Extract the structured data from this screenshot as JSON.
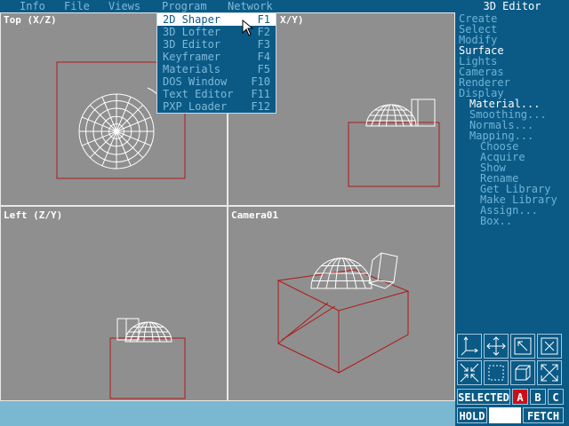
{
  "menu": {
    "items": [
      "Info",
      "File",
      "Views",
      "Program",
      "Network"
    ]
  },
  "dropdown": {
    "items": [
      {
        "label": "2D Shaper",
        "key": "F1",
        "selected": true
      },
      {
        "label": "3D Lofter",
        "key": "F2"
      },
      {
        "label": "3D Editor",
        "key": "F3"
      },
      {
        "label": "Keyframer",
        "key": "F4"
      },
      {
        "label": "Materials",
        "key": "F5"
      },
      {
        "label": "DOS Window",
        "key": "F10"
      },
      {
        "label": "Text Editor",
        "key": "F11"
      },
      {
        "label": "PXP Loader",
        "key": "F12"
      }
    ]
  },
  "viewports": {
    "top": "Top (X/Z)",
    "front_partial": "X/Y)",
    "left": "Left (Z/Y)",
    "camera": "Camera01"
  },
  "panel": {
    "title": "3D Editor",
    "items": [
      "Create",
      "Select",
      "Modify",
      "Surface",
      "Lights",
      "Cameras",
      "Renderer",
      "Display"
    ],
    "sub1": [
      "Material...",
      "Smoothing...",
      "Normals...",
      "Mapping..."
    ],
    "sub2": [
      "Choose",
      "Acquire",
      "Show",
      "Rename",
      "Get Library",
      "Make Library",
      "Assign...",
      "Box.."
    ],
    "active": "Surface"
  },
  "tools": {
    "selected_label": "SELECTED",
    "a": "A",
    "b": "B",
    "c": "C",
    "hold_label": "HOLD",
    "fetch_label": "FETCH",
    "icons": [
      "axis-icon",
      "move-icon",
      "zoom-extents-icon",
      "zoom-window-icon",
      "zoom-in-icon",
      "region-icon",
      "box-icon",
      "full-screen-icon"
    ]
  },
  "colors": {
    "bg": "#0b5a86",
    "viewport": "#8f8f8f",
    "wire": "#ffffff",
    "box": "#b01818",
    "menu_text": "#7fb9d8",
    "selected_a": "#c8101a",
    "status": "#7ab8d2"
  }
}
